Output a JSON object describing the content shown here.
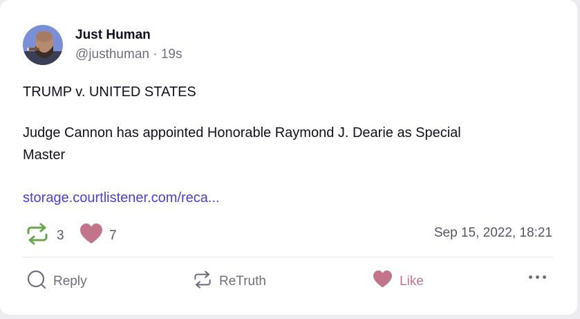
{
  "post": {
    "display_name": "Just Human",
    "handle": "@justhuman",
    "separator": "·",
    "age": "19s",
    "text_line1": "TRUMP v. UNITED STATES",
    "text_line2": "Judge Cannon has appointed Honorable Raymond J. Dearie as Special",
    "text_line3": "Master",
    "link": "storage.courtlistener.com/reca...",
    "retruth_count": "3",
    "like_count": "7",
    "timestamp": "Sep 15, 2022, 18:21"
  },
  "actions": {
    "reply_label": "Reply",
    "retruth_label": "ReTruth",
    "like_label": "Like"
  },
  "icons": {
    "retruth_stat": "retruth-icon",
    "like_stat": "heart-icon",
    "reply": "reply-icon",
    "retruth": "retruth-icon",
    "like": "heart-icon",
    "more": "more-icon"
  },
  "colors": {
    "retruth_green": "#6aa84f",
    "like_pink": "#c2748b",
    "link_blue": "#4b3fd6"
  }
}
